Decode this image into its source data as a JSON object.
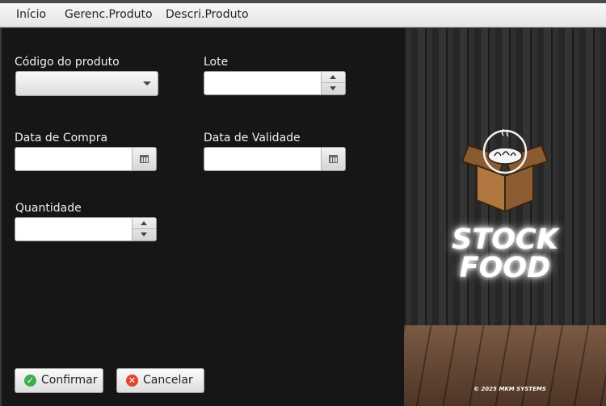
{
  "menu": {
    "items": [
      "Início",
      "Gerenc.Produto",
      "Descri.Produto"
    ]
  },
  "form": {
    "codigo_label": "Código do produto",
    "codigo_value": "",
    "lote_label": "Lote",
    "lote_value": "",
    "data_compra_label": "Data de Compra",
    "data_compra_value": "",
    "data_validade_label": "Data de Validade",
    "data_validade_value": "",
    "quantidade_label": "Quantidade",
    "quantidade_value": ""
  },
  "buttons": {
    "confirm_label": "Confirmar",
    "cancel_label": "Cancelar"
  },
  "brand": {
    "line1": "STOCK",
    "line2": "FOOD",
    "credit": "© 2025 MKM SYSTEMS"
  },
  "colors": {
    "confirm_icon": "#3eaf4e",
    "cancel_icon": "#e0452e",
    "box": "#a8703e",
    "panel_bg": "#161616"
  },
  "icons": [
    "chevron-down-icon",
    "calendar-icon",
    "spin-up-icon",
    "spin-down-icon",
    "check-circle-icon",
    "x-circle-icon",
    "food-box-logo-icon"
  ]
}
